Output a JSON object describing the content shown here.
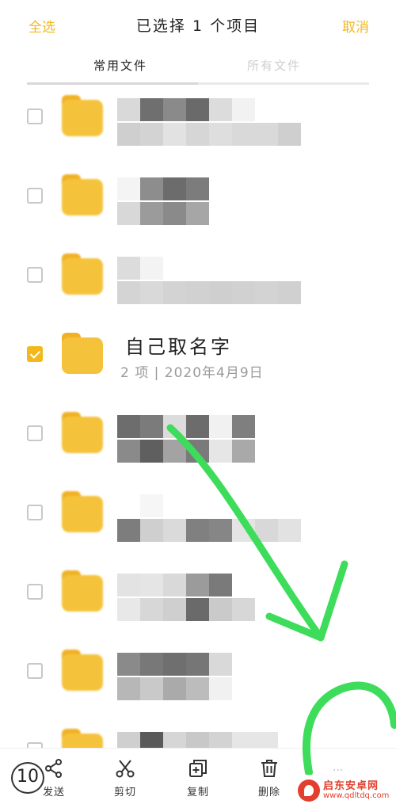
{
  "header": {
    "select_all": "全选",
    "title": "已选择 1 个项目",
    "cancel": "取消"
  },
  "tabs": [
    {
      "label": "常用文件",
      "active": true
    },
    {
      "label": "所有文件",
      "active": false
    }
  ],
  "colors": {
    "accent": "#f2b81c",
    "folder": "#f5c33b",
    "annotation": "#3ddc5a"
  },
  "files": [
    {
      "name": "",
      "meta": "",
      "checked": false,
      "pixelated": true
    },
    {
      "name": "",
      "meta": "",
      "checked": false,
      "pixelated": true
    },
    {
      "name": "",
      "meta": "",
      "checked": false,
      "pixelated": true
    },
    {
      "name": "自己取名字",
      "meta": "2 项 | 2020年4月9日",
      "checked": true,
      "pixelated": false
    },
    {
      "name": "",
      "meta": "",
      "checked": false,
      "pixelated": true
    },
    {
      "name": "",
      "meta": "",
      "checked": false,
      "pixelated": true
    },
    {
      "name": "",
      "meta": "",
      "checked": false,
      "pixelated": true
    },
    {
      "name": "",
      "meta": "",
      "checked": false,
      "pixelated": true
    },
    {
      "name": "",
      "meta": "",
      "checked": false,
      "pixelated": true
    }
  ],
  "actions": {
    "send": {
      "label": "发送",
      "icon": "share-icon"
    },
    "cut": {
      "label": "剪切",
      "icon": "scissors-icon"
    },
    "copy": {
      "label": "复制",
      "icon": "copy-icon"
    },
    "delete": {
      "label": "删除",
      "icon": "trash-icon"
    },
    "more": {
      "label": "···",
      "icon": "more-icon"
    }
  },
  "annotation": {
    "page_number": "10"
  },
  "watermark": {
    "title": "启东安卓网",
    "url": "www.qdltdq.com"
  }
}
